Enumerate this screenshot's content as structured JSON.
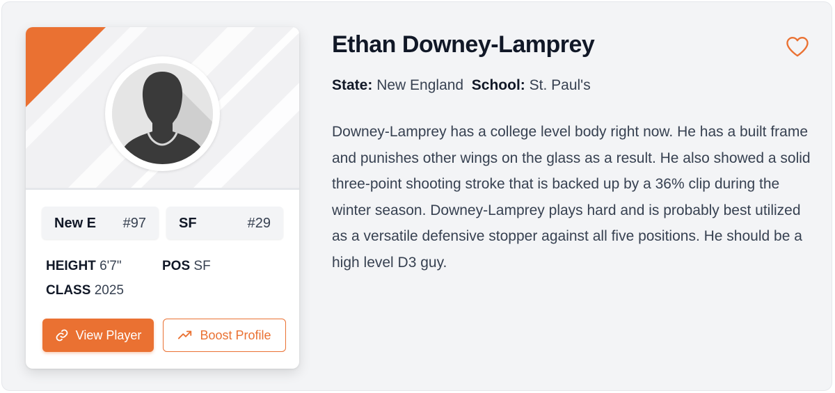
{
  "player": {
    "name": "Ethan Downey-Lamprey",
    "state_label": "State:",
    "state": "New England",
    "school_label": "School:",
    "school": "St. Paul's",
    "description": "Downey-Lamprey has a college level body right now. He has a built frame and punishes other wings on the glass as a result. He also showed a solid three-point shooting stroke that is backed up by a 36% clip during the winter season. Downey-Lamprey plays hard and is probably best utilized as a versatile defensive stopper against all five positions. He should be a high level D3 guy."
  },
  "card": {
    "rankings": [
      {
        "label": "New E",
        "rank": "#97"
      },
      {
        "label": "SF",
        "rank": "#29"
      }
    ],
    "height_label": "HEIGHT",
    "height": "6'7\"",
    "pos_label": "POS",
    "pos": "SF",
    "class_label": "CLASS",
    "class": "2025",
    "view_button": "View Player",
    "boost_button": "Boost Profile"
  },
  "icons": {
    "view": "link-icon",
    "boost": "trending-up-icon",
    "favorite": "heart-icon",
    "avatar": "person-silhouette-icon"
  },
  "colors": {
    "accent": "#ea7132",
    "background": "#f3f4f6",
    "text_dark": "#111827",
    "text_body": "#374151"
  }
}
